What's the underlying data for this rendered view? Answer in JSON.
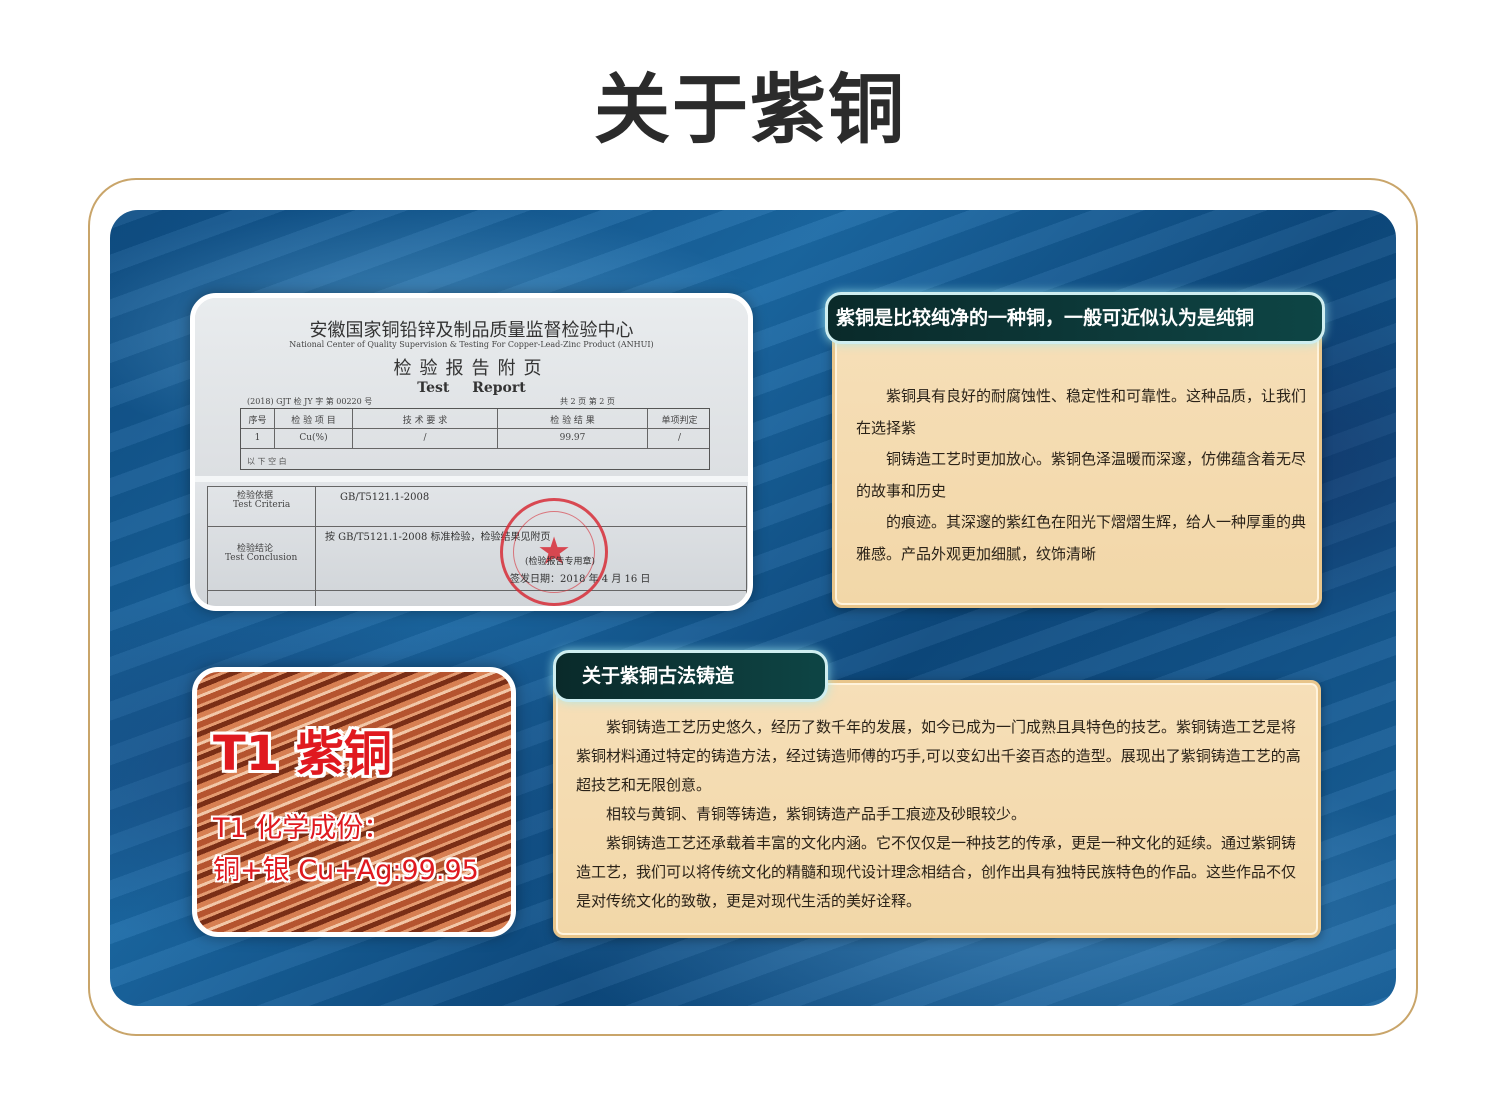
{
  "page": {
    "title": "关于紫铜"
  },
  "certificate": {
    "org_cn": "安徽国家铜铅锌及制品质量监督检验中心",
    "org_en": "National Center of Quality Supervision & Testing For Copper-Lead-Zinc Product (ANHUI)",
    "report_cn": "检验报告附页",
    "report_en": "Test Report",
    "report_no": "(2018) GJT 检 JY 字 第 00220 号",
    "page_info": "共 2 页 第 2 页",
    "table_headers": [
      "序号",
      "检 验 项 目",
      "技 术 要 求",
      "检 验 结 果",
      "单项判定"
    ],
    "table_row": [
      "1",
      "Cu(%)",
      "/",
      "99.97",
      "/"
    ],
    "blank_row": "以 下 空 白",
    "criteria_cn": "检验依据",
    "criteria_en": "Test Criteria",
    "criteria_value": "GB/T5121.1-2008",
    "conclusion_cn": "检验结论",
    "conclusion_en": "Test Conclusion",
    "conclusion_value": "按 GB/T5121.1-2008 标准检验，检验结果见附页",
    "stamp_text": "(检验报告专用章)",
    "issue_date": "签发日期：2018 年 4 月 16 日"
  },
  "wire_photo": {
    "title": "T1 紫铜",
    "line1": "T1 化学成份：",
    "line2": "铜+银 Cu+Ag:99.95"
  },
  "card_purity": {
    "tab_label": "紫铜是比较纯净的一种铜，一般可近似认为是纯铜",
    "paragraphs": [
      "紫铜具有良好的耐腐蚀性、稳定性和可靠性。这种品质，让我们在选择紫",
      "铜铸造工艺时更加放心。紫铜色泽温暖而深邃，仿佛蕴含着无尽的故事和历史",
      "的痕迹。其深邃的紫红色在阳光下熠熠生辉，给人一种厚重的典雅感。产品外观更加细腻，纹饰清晰"
    ]
  },
  "card_casting": {
    "tab_label": "关于紫铜古法铸造",
    "paragraphs": [
      "紫铜铸造工艺历史悠久，经历了数千年的发展，如今已成为一门成熟且具特色的技艺。紫铜铸造工艺是将紫铜材料通过特定的铸造方法，经过铸造师傅的巧手,可以变幻出千姿百态的造型。展现出了紫铜铸造工艺的高超技艺和无限创意。",
      "相较与黄铜、青铜等铸造，紫铜铸造产品手工痕迹及砂眼较少。",
      "紫铜铸造工艺还承载着丰富的文化内涵。它不仅仅是一种技艺的传承，更是一种文化的延续。通过紫铜铸造工艺，我们可以将传统文化的精髓和现代设计理念相结合，创作出具有独特民族特色的作品。这些作品不仅是对传统文化的致敬，更是对现代生活的美好诠释。"
    ]
  },
  "colors": {
    "frame_gold": "#c9a56a",
    "panel_blue": "#1b6aa6",
    "card_cream": "#f4dbb0",
    "tab_dark": "#0a2a2a",
    "wire_text_red": "#e0191f"
  }
}
